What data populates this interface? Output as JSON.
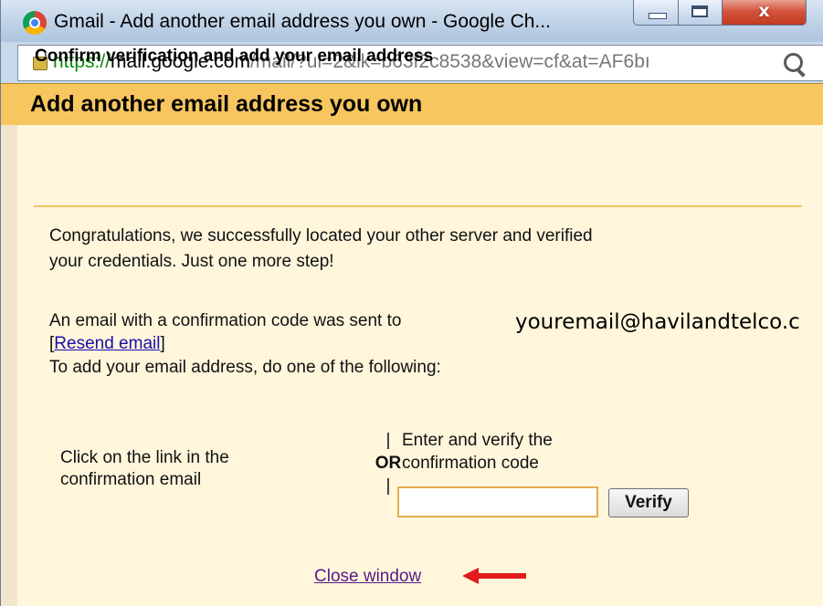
{
  "window": {
    "title": "Gmail - Add another email address you own - Google Ch...",
    "buttons": {
      "minimize": "minimize-icon",
      "maximize": "maximize-icon",
      "close": "x"
    }
  },
  "address_bar": {
    "scheme": "https://",
    "host": "mail.google.com",
    "path": "/mail/?ui=2&ik=b63f2c8538&view=cf&at=AF6bı",
    "secure_icon": "lock-icon",
    "search_icon": "search-icon"
  },
  "dialog": {
    "header": "Add another email address you own",
    "subtitle": "Confirm verification and add your email address",
    "congrats_line1": "Congratulations, we successfully located your other server and verified",
    "congrats_line2": "your credentials. Just one more step!",
    "sent_prefix": "An email with a confirmation code was sent to",
    "email_address": "youremail@havilandtelco.c",
    "resend_open_bracket": "[",
    "resend_link": "Resend email",
    "resend_close_bracket": "]",
    "instructions": "To add your email address, do one of the following:",
    "option_link_line1": "Click on the link in the",
    "option_link_line2": "confirmation email",
    "separator_bar": "|",
    "separator_or": "OR",
    "option_code_line1": "Enter and verify the",
    "option_code_line2": "confirmation code",
    "code_value": "",
    "verify_button": "Verify",
    "close_link": "Close window"
  },
  "colors": {
    "header_bg": "#f7c65e",
    "body_bg": "#fff6dc",
    "link": "#1a0dab",
    "visited_link": "#551a8b",
    "annotation_arrow": "#e21b1b"
  }
}
